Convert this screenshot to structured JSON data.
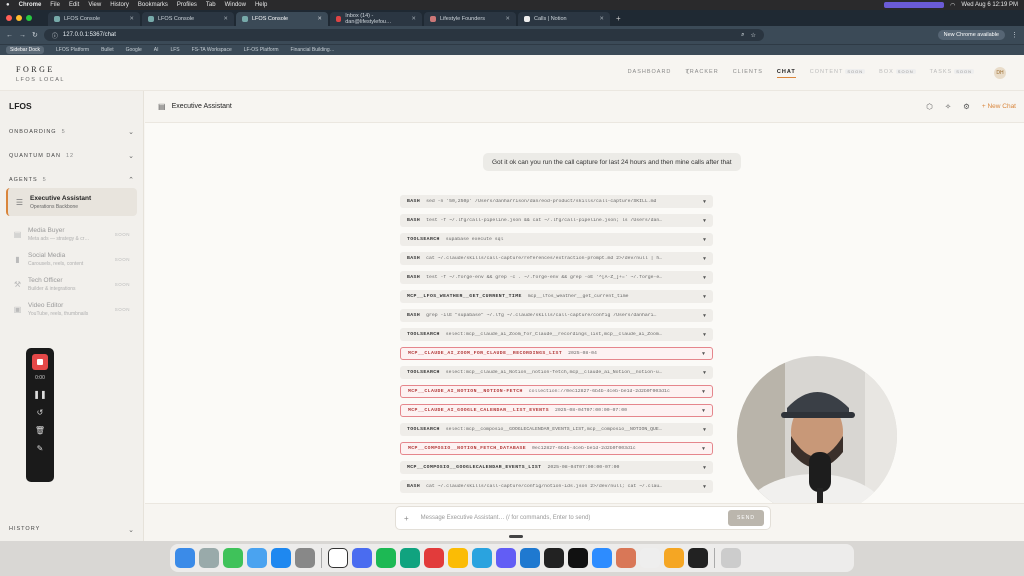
{
  "macos": {
    "menu": [
      "Chrome",
      "File",
      "Edit",
      "View",
      "History",
      "Bookmarks",
      "Profiles",
      "Tab",
      "Window",
      "Help"
    ],
    "clock": "Wed Aug 6  12:19 PM"
  },
  "browser": {
    "tabs": [
      {
        "label": "LFOS Console",
        "active": false
      },
      {
        "label": "LFOS Console",
        "active": false
      },
      {
        "label": "LFOS Console",
        "active": true
      },
      {
        "label": "Inbox (14) - dan@lifestylefou…",
        "active": false
      },
      {
        "label": "Lifestyle Founders",
        "active": false
      },
      {
        "label": "Calls | Notion",
        "active": false
      }
    ],
    "url": "127.0.0.1:5367/chat",
    "relaunch": "New Chrome available",
    "ask_gemini": "Ask Gemini",
    "bookmarks": [
      "Sidebar Dock",
      "LFOS Platform",
      "Bullet",
      "Google",
      "AI",
      "LFS",
      "FS-TA Workspace",
      "LF-OS Platform",
      "Financial Building…"
    ]
  },
  "app": {
    "brand": "FORGE",
    "brand_sub": "LFOS LOCAL",
    "nav": [
      {
        "label": "DASHBOARD",
        "state": "normal"
      },
      {
        "label": "TRACKER",
        "state": "normal"
      },
      {
        "label": "CLIENTS",
        "state": "normal"
      },
      {
        "label": "CHAT",
        "state": "active"
      },
      {
        "label": "CONTENT",
        "state": "dim",
        "badge": "SOON"
      },
      {
        "label": "BOX",
        "state": "dim",
        "badge": "SOON"
      },
      {
        "label": "TASKS",
        "state": "dim",
        "badge": "SOON"
      }
    ],
    "avatar": "DH"
  },
  "sidebar": {
    "title": "LFOS",
    "sections": [
      {
        "label": "ONBOARDING",
        "count": "5"
      },
      {
        "label": "QUANTUM DAN",
        "count": "12"
      },
      {
        "label": "AGENTS",
        "count": "5"
      }
    ],
    "agents": [
      {
        "name": "Executive Assistant",
        "desc": "Operations Backbone",
        "status": "",
        "icon": "☰"
      },
      {
        "name": "Media Buyer",
        "desc": "Meta ads — strategy & cr…",
        "status": "SOON",
        "icon": "▤"
      },
      {
        "name": "Social Media",
        "desc": "Carousels, reels, content",
        "status": "SOON",
        "icon": "▮"
      },
      {
        "name": "Tech Officer",
        "desc": "Builder & integrations",
        "status": "SOON",
        "icon": "⚒"
      },
      {
        "name": "Video Editor",
        "desc": "YouTube, reels, thumbnails",
        "status": "SOON",
        "icon": "▣"
      }
    ],
    "history": "HISTORY"
  },
  "recorder": {
    "time": "0:00"
  },
  "chat": {
    "title": "Executive Assistant",
    "new_chat": "+ New Chat",
    "user_message": "Got it ok can you run the call capture for last 24 hours and then mine calls after that",
    "tools": [
      {
        "tag": "BASH",
        "cmd": "sed -n '50,250p' /Users/danharrison/dan/eod-product/skills/call-capture/SKILL.md",
        "err": false
      },
      {
        "tag": "BASH",
        "cmd": "test -f ~/.lfg/call-pipeline.json && cat ~/.lfg/call-pipeline.json; ls /Users/dan…",
        "err": false
      },
      {
        "tag": "TOOLSEARCH",
        "cmd": "supabase execute sql",
        "err": false
      },
      {
        "tag": "BASH",
        "cmd": "cat ~/.claude/skills/call-capture/references/extraction-prompt.md 2>/dev/null | h…",
        "err": false
      },
      {
        "tag": "BASH",
        "cmd": "test -f ~/.forge-env && grep -c . ~/.forge-env && grep -oE '^[A-Z_]+=' ~/.forge-e…",
        "err": false
      },
      {
        "tag": "MCP__LFOS_WEATHER__GET_CURRENT_TIME",
        "cmd": "mcp__lfos_weather__get_current_time",
        "err": false
      },
      {
        "tag": "BASH",
        "cmd": "grep -ilE \"supabase\" ~/.lfg ~/.claude/skills/call-capture/config /Users/danhari…",
        "err": false
      },
      {
        "tag": "TOOLSEARCH",
        "cmd": "select:mcp__claude_ai_Zoom_for_Claude__recordings_list,mcp__claude_ai_Zoom…",
        "err": false
      },
      {
        "tag": "MCP__CLAUDE_AI_ZOOM_FOR_CLAUDE__RECORDINGS_LIST",
        "cmd": "2025-08-04",
        "err": true
      },
      {
        "tag": "TOOLSEARCH",
        "cmd": "select:mcp__claude_ai_Notion__notion-fetch,mcp__claude_ai_Notion__notion-u…",
        "err": false
      },
      {
        "tag": "MCP__CLAUDE_AI_NOTION__NOTION-FETCH",
        "cmd": "collection://0ec12827-6b4b-4ceb-be1d-2d2b0f003d1c",
        "err": true
      },
      {
        "tag": "MCP__CLAUDE_AI_GOOGLE_CALENDAR__LIST_EVENTS",
        "cmd": "2025-08-04T07:00:00-07:00",
        "err": true
      },
      {
        "tag": "TOOLSEARCH",
        "cmd": "select:mcp__composio__GOOGLECALENDAR_EVENTS_LIST,mcp__composio__NOTION_QUE…",
        "err": false
      },
      {
        "tag": "MCP__COMPOSIO__NOTION_FETCH_DATABASE",
        "cmd": "0ec12827-6b4b-4ceb-be1d-2d2b0f003d1c",
        "err": true
      },
      {
        "tag": "MCP__COMPOSIO__GOOGLECALENDAR_EVENTS_LIST",
        "cmd": "2025-08-04T07:00:00-07:00",
        "err": false
      },
      {
        "tag": "BASH",
        "cmd": "cat ~/.claude/skills/call-capture/config/notion-ids.json 2>/dev/null; cat ~/.clau…",
        "err": false
      }
    ],
    "placeholder": "Message Executive Assistant… (/ for commands, Enter to send)",
    "send": "SEND"
  },
  "colors": {
    "accent": "#d9853b",
    "error": "#e5868c",
    "record": "#e54848"
  }
}
